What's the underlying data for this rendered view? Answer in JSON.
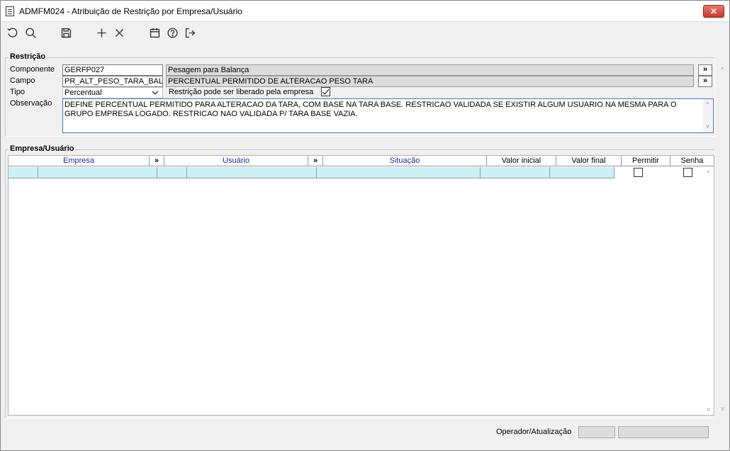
{
  "window": {
    "title": "ADMFM024 - Atribuição de Restrição por Empresa/Usuário",
    "close_label": "✕"
  },
  "toolbar": {
    "items": [
      "refresh-icon",
      "search-icon",
      "save-icon",
      "add-icon",
      "delete-icon",
      "calendar-icon",
      "help-icon",
      "exit-icon"
    ]
  },
  "restricao": {
    "section_title": "Restrição",
    "componente_label": "Componente",
    "componente_value": "GERFP027",
    "componente_desc": "Pesagem para Balança",
    "campo_label": "Campo",
    "campo_value": "PR_ALT_PESO_TARA_BAL",
    "campo_desc": "PERCENTUAL PERMITIDO DE ALTERACAO PESO TARA",
    "tipo_label": "Tipo",
    "tipo_value": "Percentual",
    "liberado_label": "Restrição pode ser liberado pela empresa",
    "liberado_checked": true,
    "observacao_label": "Observação",
    "observacao_value": "DEFINE PERCENTUAL PERMITIDO PARA ALTERACAO DA TARA, COM BASE NA TARA BASE. RESTRICAO VALIDADA SE EXISTIR ALGUM USUARIO NA MESMA PARA  O GRUPO EMPRESA LOGADO. RESTRICAO NAO VALIDADA P/ TARA BASE VAZIA.",
    "lookup_btn": "»"
  },
  "empresa_usuario": {
    "section_title": "Empresa/Usuário",
    "columns": {
      "empresa": "Empresa",
      "sort1": "»",
      "usuario": "Usuário",
      "sort2": "»",
      "situacao": "Situação",
      "valor_inicial": "Valor inicial",
      "valor_final": "Valor final",
      "permitir": "Permitir",
      "senha": "Senha"
    }
  },
  "footer": {
    "operador_label": "Operador/Atualização"
  },
  "colors": {
    "selection_row": "#cdf0f7",
    "header_blue": "#1e2b9e",
    "close_red": "#c7392a"
  }
}
